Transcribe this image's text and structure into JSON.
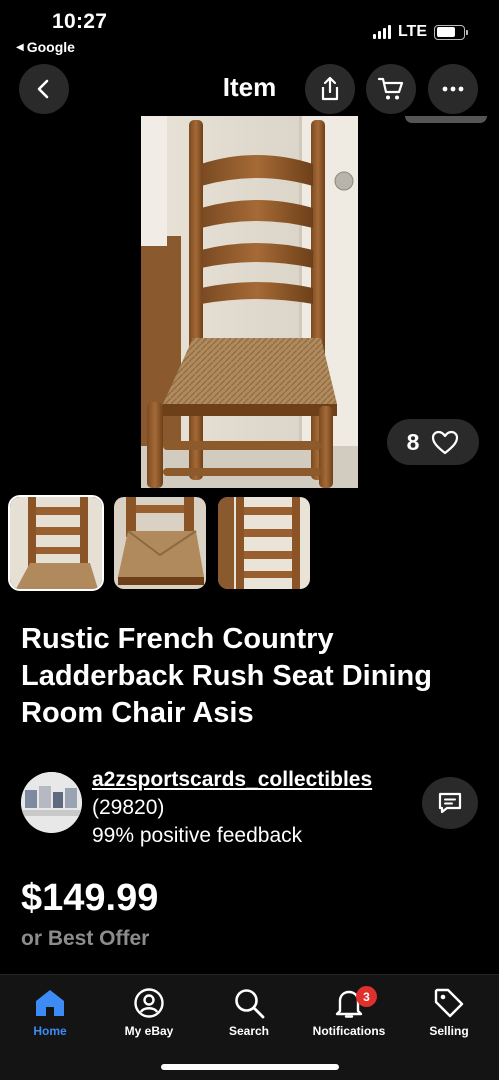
{
  "status_bar": {
    "time": "10:27",
    "back_app": "Google",
    "network": "LTE"
  },
  "header": {
    "title": "Item",
    "icons": [
      "back-arrow-icon",
      "share-icon",
      "cart-icon",
      "more-icon"
    ]
  },
  "listing": {
    "like_count": "8",
    "title": "Rustic French Country Ladderback Rush Seat Dining Room Chair Asis",
    "price": "$149.99",
    "offer_text": "or Best Offer",
    "thumbnail_count": 3
  },
  "seller": {
    "name": "a2zsportscards_collectibles",
    "count": "(29820)",
    "feedback": "99% positive feedback"
  },
  "tabs": [
    {
      "label": "Home",
      "icon": "home-icon",
      "active": true
    },
    {
      "label": "My eBay",
      "icon": "profile-icon",
      "active": false
    },
    {
      "label": "Search",
      "icon": "search-icon",
      "active": false
    },
    {
      "label": "Notifications",
      "icon": "bell-icon",
      "active": false,
      "badge": "3"
    },
    {
      "label": "Selling",
      "icon": "tag-icon",
      "active": false
    }
  ],
  "colors": {
    "background": "#000000",
    "accent": "#3d8bf5",
    "badge": "#e0302d",
    "muted": "#8c8c8c"
  }
}
